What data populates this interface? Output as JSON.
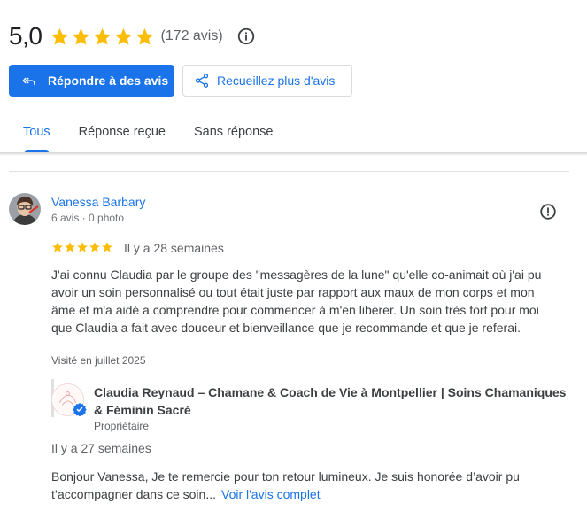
{
  "summary": {
    "rating": "5,0",
    "stars": 5,
    "count": "(172 avis)",
    "star_color": "#fbbc04"
  },
  "actions": {
    "reply_label": "Répondre à des avis",
    "collect_label": "Recueillez plus d'avis",
    "accent": "#1a73e8"
  },
  "tabs": [
    {
      "label": "Tous",
      "active": true
    },
    {
      "label": "Réponse reçue",
      "active": false
    },
    {
      "label": "Sans réponse",
      "active": false
    }
  ],
  "review": {
    "author": "Vanessa Barbary",
    "meta": "6 avis · 0 photo",
    "stars": 5,
    "date": "Il y a 28 semaines",
    "text": "J'ai connu Claudia par le groupe des \"messagères de la lune\" qu'elle co-animait où j'ai pu avoir un soin personnalisé ou tout était juste par rapport aux maux de mon corps et mon âme et m'a aidé a comprendre pour commencer à m'en libérer. Un soin très fort pour moi que Claudia a fait avec douceur et bienveillance que je recommande et que je referai.",
    "visited": "Visité en juillet 2025"
  },
  "owner_reply": {
    "name": "Claudia Reynaud – Chamane & Coach de Vie à Montpellier | Soins Chamaniques & Féminin Sacré",
    "role": "Propriétaire",
    "date": "Il y a 27 semaines",
    "text": "Bonjour Vanessa, Je te remercie pour ton retour lumineux. Je suis honorée d’avoir pu t’accompagner dans ce soin...",
    "read_more": "Voir l'avis complet"
  }
}
